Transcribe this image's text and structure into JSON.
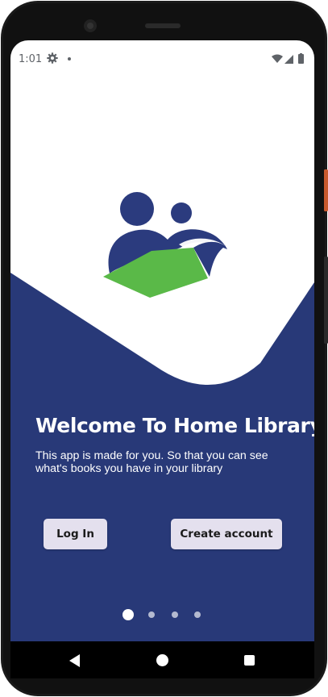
{
  "status_bar": {
    "time": "1:01",
    "icons": [
      "gear-icon",
      "notification-dot-icon",
      "wifi-icon",
      "signal-icon",
      "battery-icon"
    ]
  },
  "colors": {
    "navy": "#283978",
    "logo_blue": "#2b3b7e",
    "logo_green": "#5ab948",
    "button_bg": "#e4e0ee"
  },
  "welcome": {
    "title": "Welcome To Home Library",
    "subtitle": "This app is made for you. So that you can see what's books you have in your library"
  },
  "buttons": {
    "login_label": "Log In",
    "create_label": "Create account"
  },
  "pager": {
    "pages": 4,
    "active": 0
  },
  "nav_bar": {
    "icons": [
      "back-icon",
      "home-icon",
      "recents-icon"
    ]
  }
}
